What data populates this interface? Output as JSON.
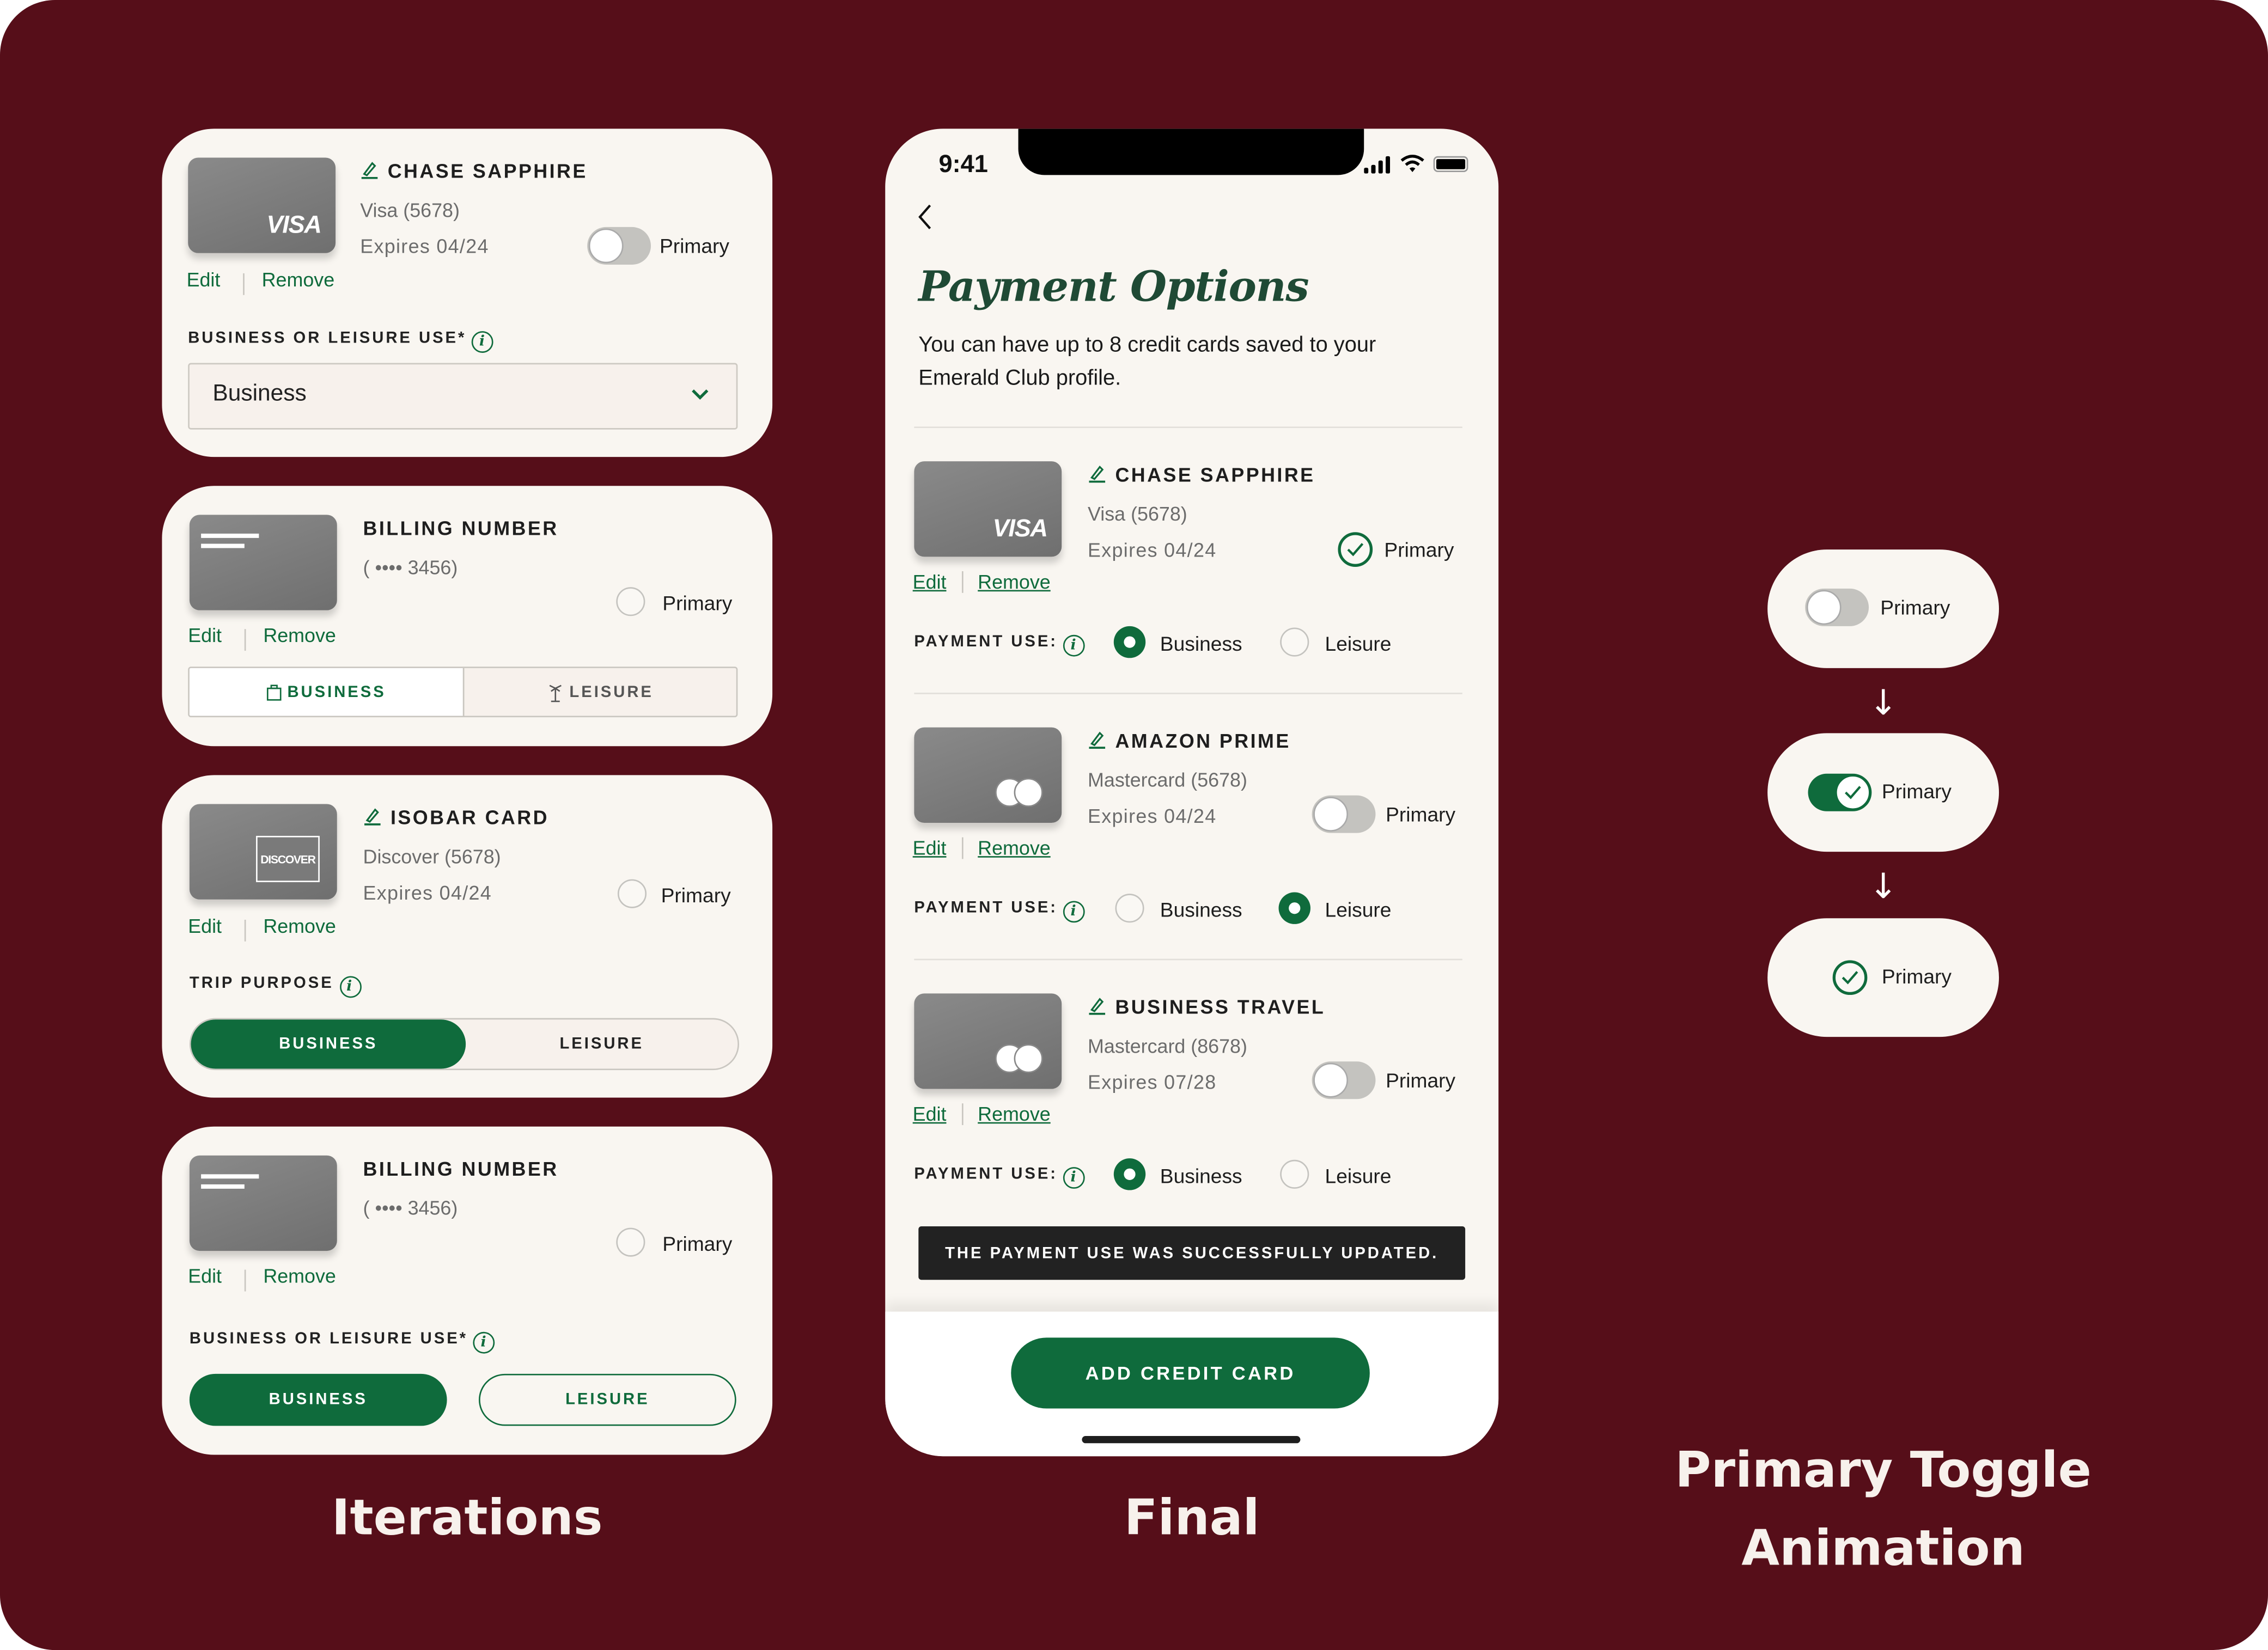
{
  "colors": {
    "background": "#560e19",
    "panel": "#f9f6f1",
    "brand_green": "#0f6b3c",
    "toast_bg": "#222222",
    "toggle_off": "#c4c3bf"
  },
  "sections": {
    "iterations_label": "Iterations",
    "final_label": "Final",
    "animation_label_line1": "Primary Toggle",
    "animation_label_line2": "Animation"
  },
  "iterations": [
    {
      "card_title": "CHASE SAPPHIRE",
      "card_type": "Visa (5678)",
      "expiry": "Expires 04/24",
      "brand": "VISA",
      "primary_label": "Primary",
      "primary_control": "toggle-off",
      "edit_label": "Edit",
      "remove_label": "Remove",
      "use_label": "BUSINESS OR LEISURE USE*",
      "select_value": "Business"
    },
    {
      "card_title": "BILLING NUMBER",
      "card_type": "( •••• 3456)",
      "primary_label": "Primary",
      "primary_control": "radio-empty",
      "edit_label": "Edit",
      "remove_label": "Remove",
      "segments": [
        {
          "label": "BUSINESS",
          "icon": "briefcase-icon",
          "selected": true
        },
        {
          "label": "LEISURE",
          "icon": "palm-tree-icon",
          "selected": false
        }
      ]
    },
    {
      "card_title": "ISOBAR CARD",
      "card_type": "Discover (5678)",
      "expiry": "Expires 04/24",
      "brand": "DISCOVER",
      "primary_label": "Primary",
      "primary_control": "radio-empty",
      "edit_label": "Edit",
      "remove_label": "Remove",
      "use_label": "TRIP PURPOSE",
      "segments": [
        {
          "label": "BUSINESS",
          "selected": true
        },
        {
          "label": "LEISURE",
          "selected": false
        }
      ]
    },
    {
      "card_title": "BILLING NUMBER",
      "card_type": "( •••• 3456)",
      "primary_label": "Primary",
      "primary_control": "radio-empty",
      "edit_label": "Edit",
      "remove_label": "Remove",
      "use_label": "BUSINESS OR LEISURE USE*",
      "buttons": [
        {
          "label": "BUSINESS",
          "selected": true
        },
        {
          "label": "LEISURE",
          "selected": false
        }
      ]
    }
  ],
  "phone": {
    "status_time": "9:41",
    "page_title": "Payment Options",
    "description": "You can have up to 8 credit cards saved to your Emerald Club profile.",
    "payment_use_label": "PAYMENT USE:",
    "option_business": "Business",
    "option_leisure": "Leisure",
    "primary_label": "Primary",
    "edit_label": "Edit",
    "remove_label": "Remove",
    "cards": [
      {
        "title": "CHASE SAPPHIRE",
        "type": "Visa (5678)",
        "expiry": "Expires 04/24",
        "brand": "VISA",
        "primary": true,
        "payment_use": "Business"
      },
      {
        "title": "AMAZON PRIME",
        "type": "Mastercard (5678)",
        "expiry": "Expires 04/24",
        "brand": "Mastercard",
        "primary": false,
        "payment_use": "Leisure"
      },
      {
        "title": "BUSINESS TRAVEL",
        "type": "Mastercard (8678)",
        "expiry": "Expires 07/28",
        "brand": "Mastercard",
        "primary": false,
        "payment_use": "Business"
      }
    ],
    "toast": "THE PAYMENT USE WAS SUCCESSFULLY UPDATED.",
    "add_button": "ADD CREDIT CARD"
  },
  "animation_states": [
    {
      "label": "Primary",
      "state": "toggle-off"
    },
    {
      "label": "Primary",
      "state": "toggle-on-check"
    },
    {
      "label": "Primary",
      "state": "check-circle"
    }
  ]
}
